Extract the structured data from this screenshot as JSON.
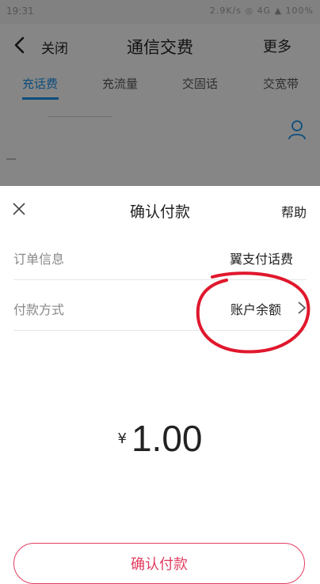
{
  "status_bar": {
    "time": "19:31",
    "right": "2.9K/s ◎ 4G ▲ 100%"
  },
  "page": {
    "back_label": "关闭",
    "title": "通信交费",
    "more_label": "更多",
    "tabs": [
      {
        "label": "充话费",
        "active": true
      },
      {
        "label": "充流量",
        "active": false
      },
      {
        "label": "交固话",
        "active": false
      },
      {
        "label": "交宽带",
        "active": false
      }
    ]
  },
  "payment_sheet": {
    "title": "确认付款",
    "help_label": "帮助",
    "order_label": "订单信息",
    "order_value": "翼支付话费",
    "method_label": "付款方式",
    "method_value": "账户余额",
    "currency_symbol": "¥",
    "amount": "1.00",
    "confirm_label": "确认付款"
  },
  "colors": {
    "accent_tab": "#1a8fe3",
    "confirm": "#e23c5f",
    "annotation": "#e0182d"
  },
  "icons": [
    "back-arrow-icon",
    "user-icon",
    "close-x-icon",
    "chevron-right-icon"
  ]
}
